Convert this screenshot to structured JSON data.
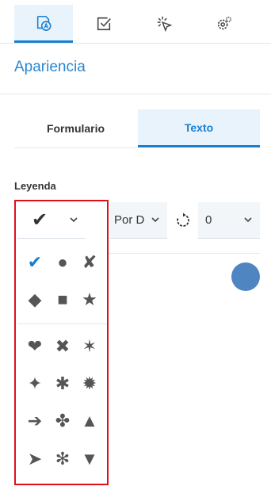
{
  "toolbar": {
    "tabs": [
      {
        "icon": "appearance-icon",
        "active": true
      },
      {
        "icon": "checkbox-icon",
        "active": false
      },
      {
        "icon": "click-icon",
        "active": false
      },
      {
        "icon": "settings-icon",
        "active": false
      }
    ]
  },
  "section": {
    "title": "Apariencia"
  },
  "subtabs": [
    {
      "label": "Formulario",
      "active": false
    },
    {
      "label": "Texto",
      "active": true
    }
  ],
  "legend": {
    "label": "Leyenda",
    "symbol_select": {
      "value": "✔"
    },
    "position_select": {
      "value": "Por D"
    },
    "rotation_select": {
      "value": "0"
    },
    "color": "#4f86c2"
  },
  "symbol_options": [
    {
      "glyph": "✔",
      "name": "check-mark",
      "selected": true
    },
    {
      "glyph": "●",
      "name": "circle",
      "selected": false
    },
    {
      "glyph": "✘",
      "name": "cross",
      "selected": false
    },
    {
      "glyph": "◆",
      "name": "diamond",
      "selected": false
    },
    {
      "glyph": "■",
      "name": "square",
      "selected": false
    },
    {
      "glyph": "★",
      "name": "star",
      "selected": false
    },
    {
      "glyph": "❤",
      "name": "heart",
      "selected": false
    },
    {
      "glyph": "✖",
      "name": "heavy-x",
      "selected": false
    },
    {
      "glyph": "✶",
      "name": "six-point-star",
      "selected": false
    },
    {
      "glyph": "✦",
      "name": "four-point-star",
      "selected": false
    },
    {
      "glyph": "✱",
      "name": "asterisk",
      "selected": false
    },
    {
      "glyph": "✹",
      "name": "twelve-point-star",
      "selected": false
    },
    {
      "glyph": "➔",
      "name": "arrow",
      "selected": false
    },
    {
      "glyph": "✤",
      "name": "clover",
      "selected": false
    },
    {
      "glyph": "▲",
      "name": "triangle-up",
      "selected": false
    },
    {
      "glyph": "➤",
      "name": "arrowhead",
      "selected": false
    },
    {
      "glyph": "✻",
      "name": "teardrop-asterisk",
      "selected": false
    },
    {
      "glyph": "▼",
      "name": "triangle-down",
      "selected": false
    }
  ],
  "colors": {
    "accent": "#1a7fd0",
    "highlight": "#e0101a"
  }
}
